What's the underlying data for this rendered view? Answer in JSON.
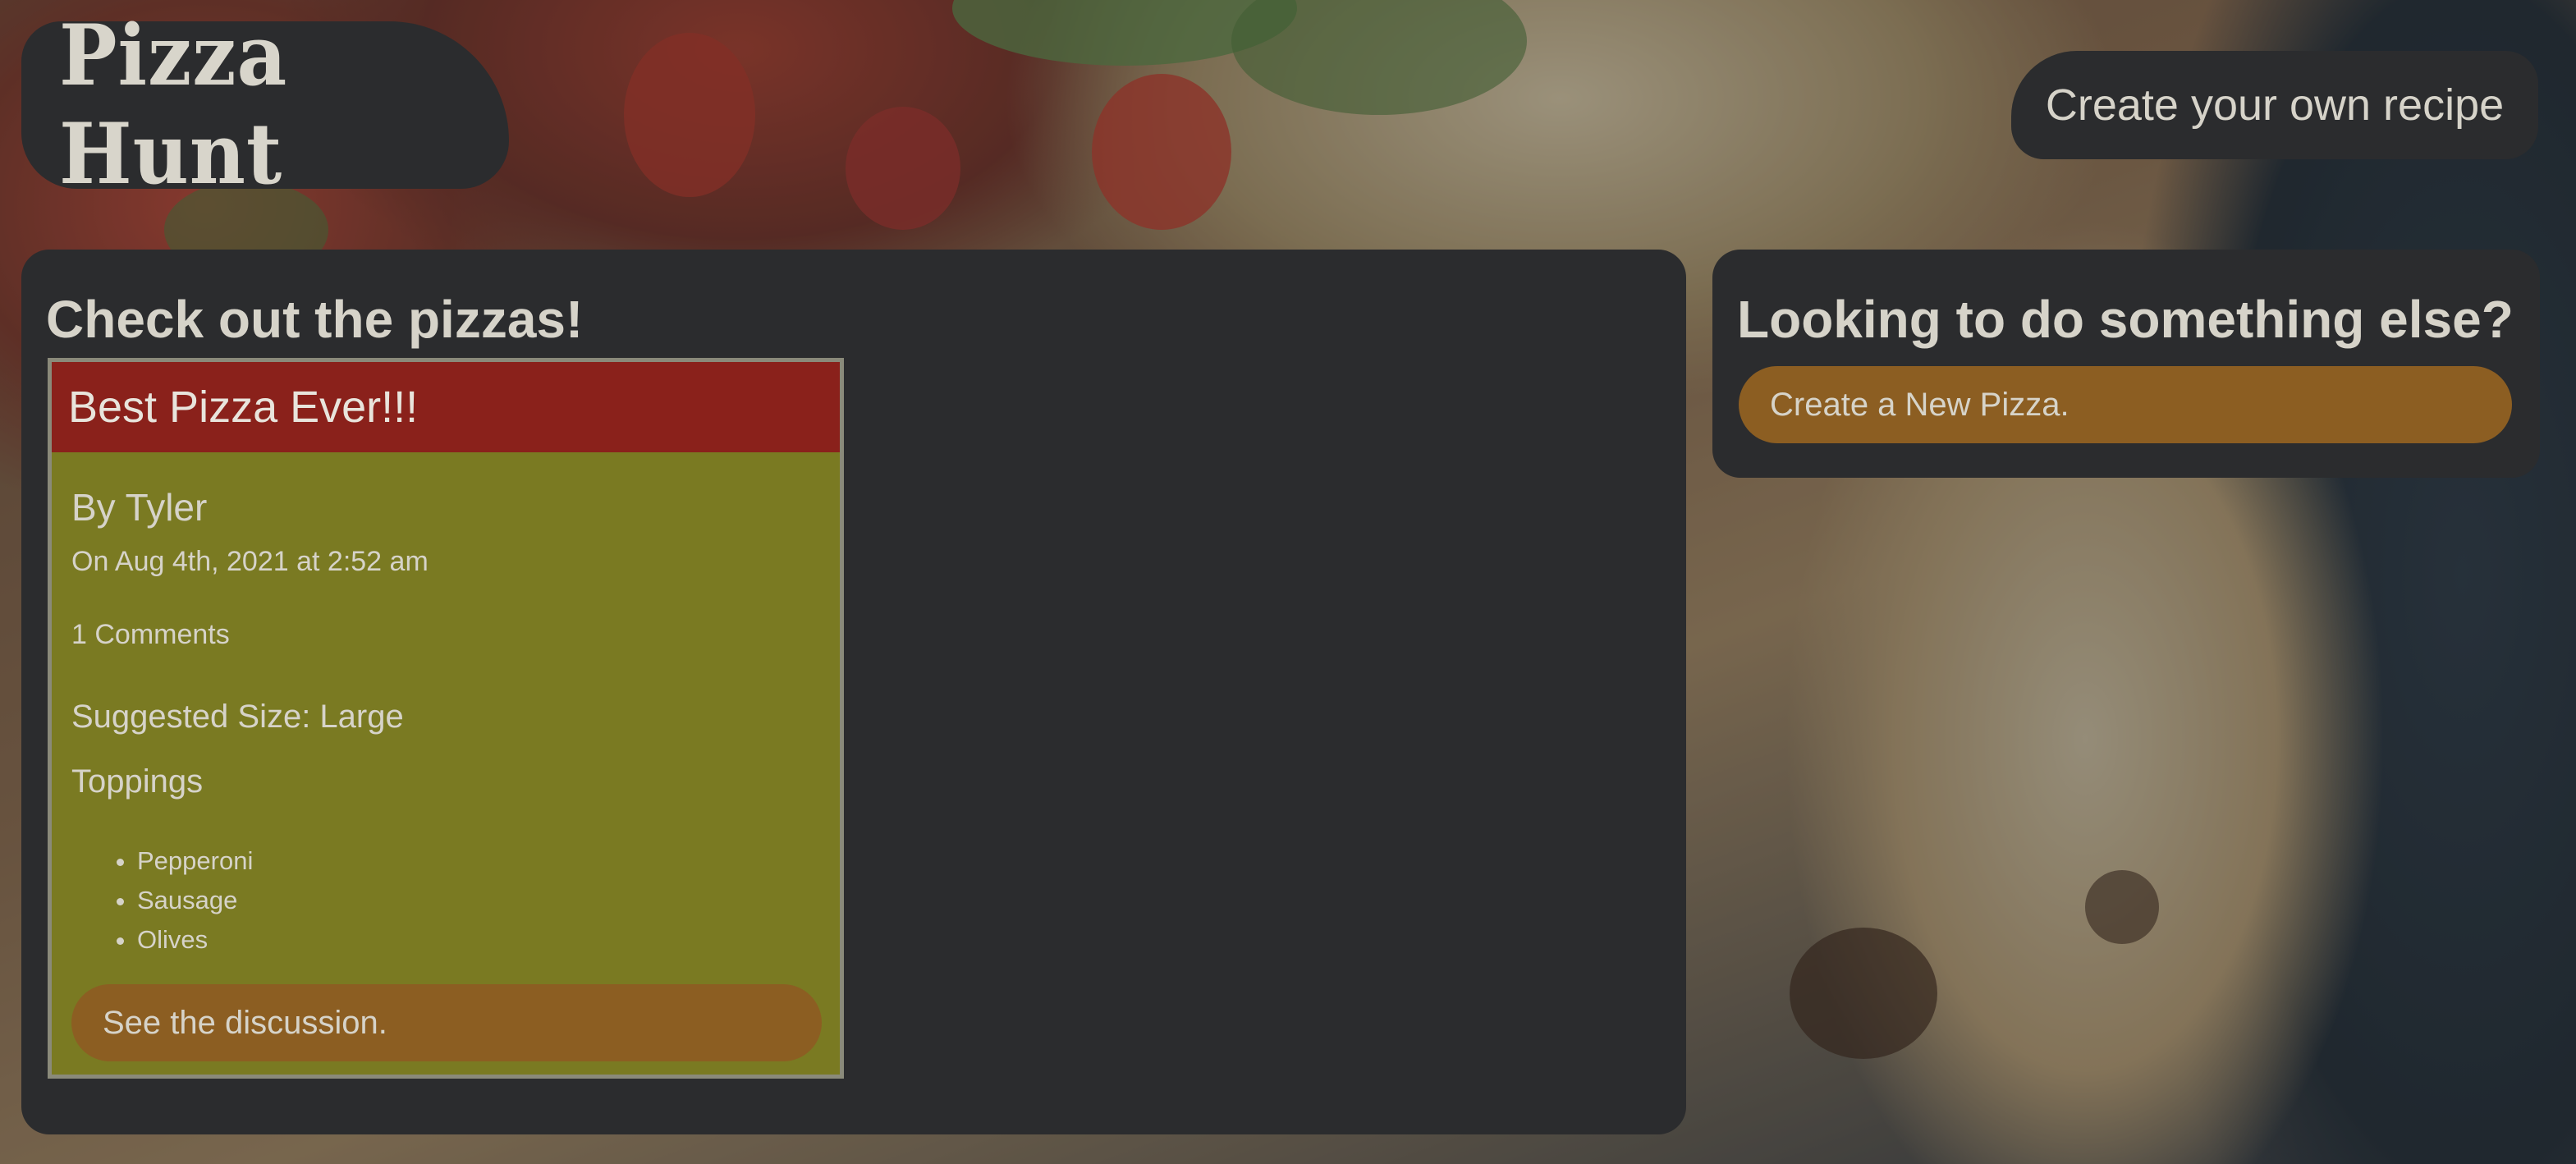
{
  "header": {
    "logo_text": "Pizza Hunt",
    "create_recipe_label": "Create your own recipe"
  },
  "main": {
    "heading": "Check out the pizzas!",
    "pizzas": [
      {
        "name": "Best Pizza Ever!!!",
        "author": "By Tyler",
        "date": "On Aug 4th, 2021 at 2:52 am",
        "comments": "1 Comments",
        "size": "Suggested Size: Large",
        "toppings_label": "Toppings",
        "toppings": [
          "Pepperoni",
          "Sausage",
          "Olives"
        ],
        "discussion_label": "See the discussion."
      }
    ]
  },
  "side": {
    "heading": "Looking to do something else?",
    "new_pizza_label": "Create a New Pizza."
  },
  "colors": {
    "panel": "#2b2c2e",
    "card": "#7a7a22",
    "card_header": "#8a211b",
    "button": "#8c5e22",
    "text": "#d6d3c9"
  }
}
